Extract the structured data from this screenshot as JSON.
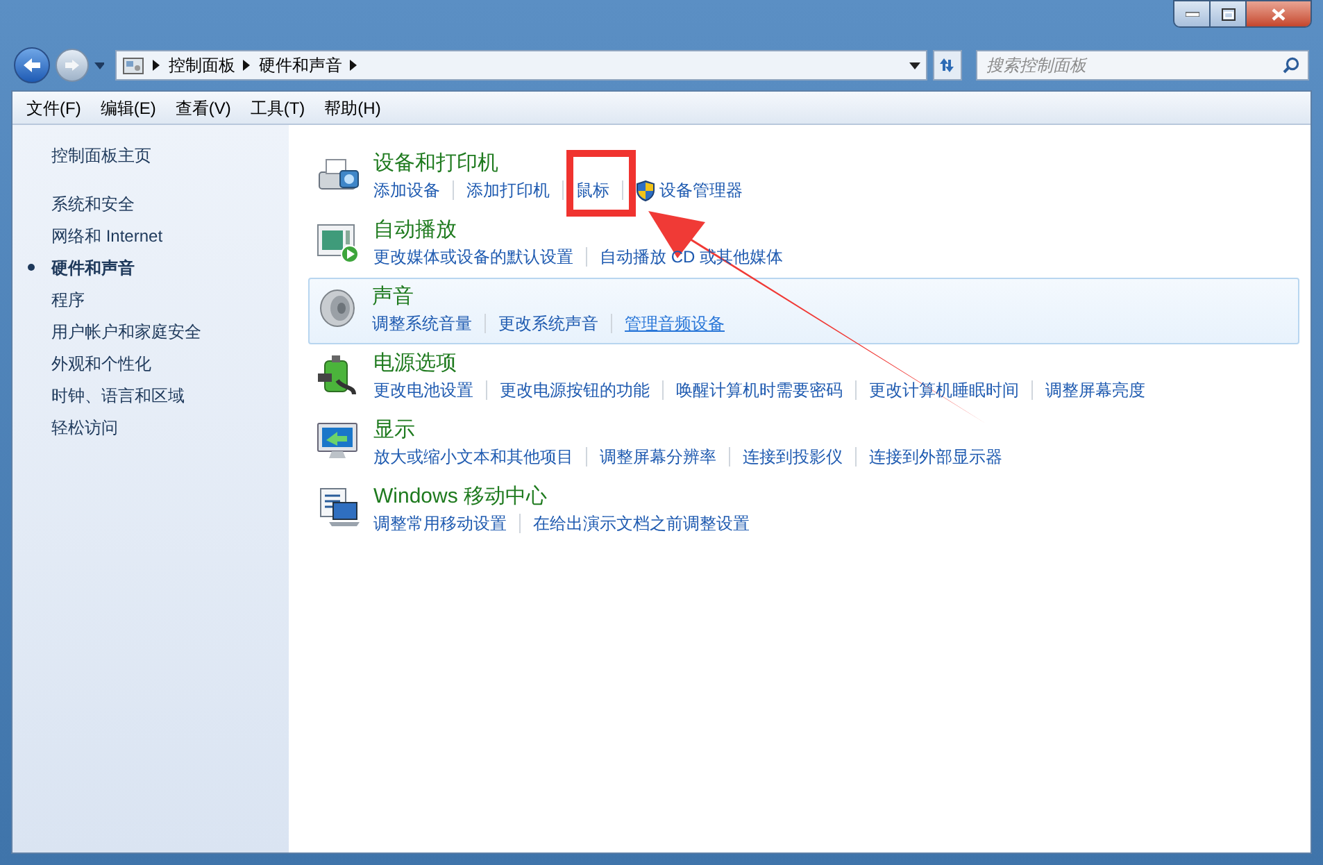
{
  "address_bar": {
    "crumbs": [
      "控制面板",
      "硬件和声音"
    ]
  },
  "search": {
    "placeholder": "搜索控制面板"
  },
  "menu": [
    "文件(F)",
    "编辑(E)",
    "查看(V)",
    "工具(T)",
    "帮助(H)"
  ],
  "sidebar": {
    "home": "控制面板主页",
    "items": [
      {
        "label": "系统和安全",
        "selected": false
      },
      {
        "label": "网络和 Internet",
        "selected": false
      },
      {
        "label": "硬件和声音",
        "selected": true
      },
      {
        "label": "程序",
        "selected": false
      },
      {
        "label": "用户帐户和家庭安全",
        "selected": false
      },
      {
        "label": "外观和个性化",
        "selected": false
      },
      {
        "label": "时钟、语言和区域",
        "selected": false
      },
      {
        "label": "轻松访问",
        "selected": false
      }
    ]
  },
  "sections": [
    {
      "kind": "printer",
      "title": "设备和打印机",
      "selected": false,
      "links": [
        {
          "label": "添加设备",
          "shield": false,
          "hovered": false
        },
        {
          "label": "添加打印机",
          "shield": false,
          "hovered": false
        },
        {
          "label": "鼠标",
          "shield": false,
          "hovered": false
        },
        {
          "label": "设备管理器",
          "shield": true,
          "hovered": false
        }
      ]
    },
    {
      "kind": "autoplay",
      "title": "自动播放",
      "selected": false,
      "links": [
        {
          "label": "更改媒体或设备的默认设置",
          "shield": false,
          "hovered": false
        },
        {
          "label": "自动播放 CD 或其他媒体",
          "shield": false,
          "hovered": false
        }
      ]
    },
    {
      "kind": "sound",
      "title": "声音",
      "selected": true,
      "links": [
        {
          "label": "调整系统音量",
          "shield": false,
          "hovered": false
        },
        {
          "label": "更改系统声音",
          "shield": false,
          "hovered": false
        },
        {
          "label": "管理音频设备",
          "shield": false,
          "hovered": true
        }
      ]
    },
    {
      "kind": "power",
      "title": "电源选项",
      "selected": false,
      "links": [
        {
          "label": "更改电池设置",
          "shield": false,
          "hovered": false
        },
        {
          "label": "更改电源按钮的功能",
          "shield": false,
          "hovered": false
        },
        {
          "label": "唤醒计算机时需要密码",
          "shield": false,
          "hovered": false
        },
        {
          "label": "更改计算机睡眠时间",
          "shield": false,
          "hovered": false
        },
        {
          "label": "调整屏幕亮度",
          "shield": false,
          "hovered": false
        }
      ]
    },
    {
      "kind": "display",
      "title": "显示",
      "selected": false,
      "links": [
        {
          "label": "放大或缩小文本和其他项目",
          "shield": false,
          "hovered": false
        },
        {
          "label": "调整屏幕分辨率",
          "shield": false,
          "hovered": false
        },
        {
          "label": "连接到投影仪",
          "shield": false,
          "hovered": false
        },
        {
          "label": "连接到外部显示器",
          "shield": false,
          "hovered": false
        }
      ]
    },
    {
      "kind": "mobility",
      "title": "Windows 移动中心",
      "selected": false,
      "links": [
        {
          "label": "调整常用移动设置",
          "shield": false,
          "hovered": false
        },
        {
          "label": "在给出演示文档之前调整设置",
          "shield": false,
          "hovered": false
        }
      ]
    }
  ],
  "annotations": {
    "highlight_box": true,
    "arrow": true
  }
}
